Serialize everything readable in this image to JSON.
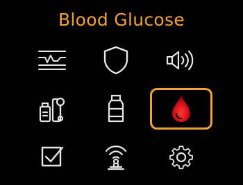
{
  "header": {
    "title": "Blood Glucose"
  },
  "colors": {
    "accent": "#f5a13a",
    "icon": "#e6e6e6",
    "drop_red": "#e0141e",
    "background": "#000000"
  },
  "menu": {
    "selected_index": 5,
    "items": [
      {
        "icon": "ecg-waveform-icon"
      },
      {
        "icon": "shield-icon"
      },
      {
        "icon": "speaker-volume-icon"
      },
      {
        "icon": "medication-kit-icon"
      },
      {
        "icon": "medicine-bottle-icon"
      },
      {
        "icon": "blood-drop-icon"
      },
      {
        "icon": "checkbox-checked-icon"
      },
      {
        "icon": "wireless-sensor-icon"
      },
      {
        "icon": "gear-icon"
      }
    ]
  }
}
